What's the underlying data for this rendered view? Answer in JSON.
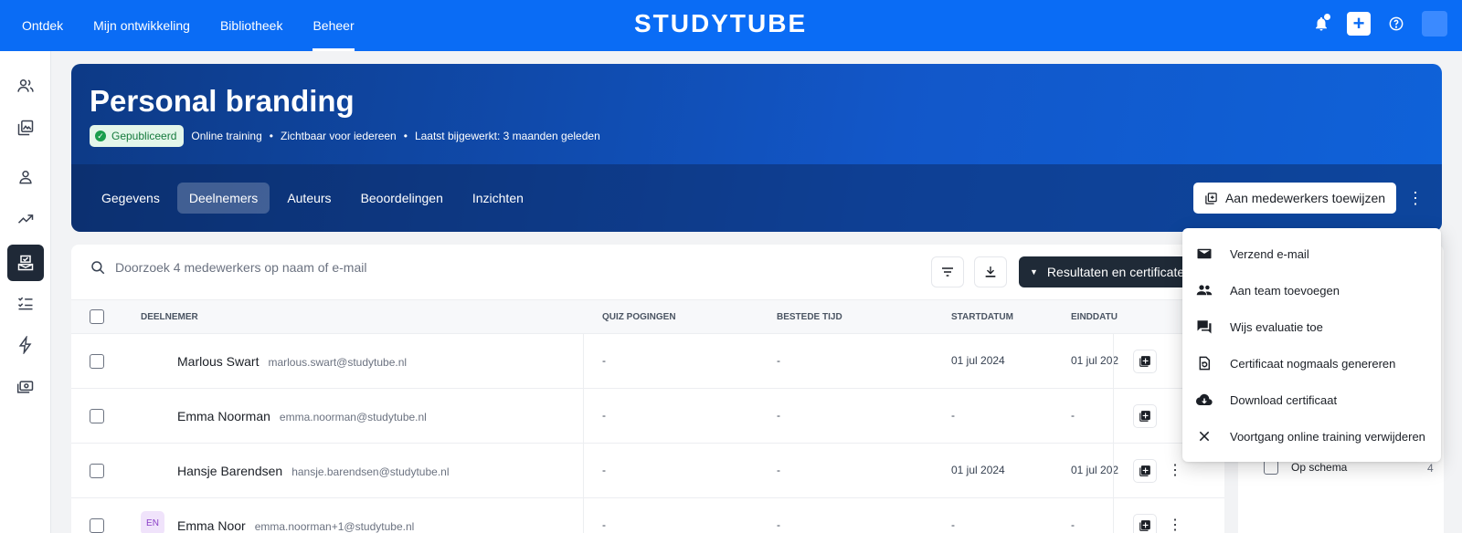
{
  "topnav": {
    "items": [
      "Ontdek",
      "Mijn ontwikkeling",
      "Bibliotheek",
      "Beheer"
    ],
    "active": "Beheer"
  },
  "brand": "STUDYTUBE",
  "colors": {
    "primary": "#0a6cf5",
    "dark": "#1f2a37",
    "published": "#1a9e4d"
  },
  "course": {
    "title": "Personal branding",
    "status": "Gepubliceerd",
    "meta": [
      "Online training",
      "Zichtbaar voor iedereen",
      "Laatst bijgewerkt: 3 maanden geleden"
    ]
  },
  "tabs": [
    "Gegevens",
    "Deelnemers",
    "Auteurs",
    "Beoordelingen",
    "Inzichten"
  ],
  "assign_button": "Aan medewerkers toewijzen",
  "search": {
    "placeholder": "Doorzoek 4 medewerkers op naam of e-mail"
  },
  "results_button": "Resultaten en certificaten",
  "table": {
    "columns": [
      "DEELNEMER",
      "QUIZ POGINGEN",
      "BESTEDE TIJD",
      "STARTDATUM",
      "EINDDATU"
    ],
    "rows": [
      {
        "name": "Marlous Swart",
        "email": "marlous.swart@studytube.nl",
        "quiz": "-",
        "time": "-",
        "start": "01 jul 2024",
        "end": "01 jul 202"
      },
      {
        "name": "Emma Noorman",
        "email": "emma.noorman@studytube.nl",
        "quiz": "-",
        "time": "-",
        "start": "-",
        "end": "-"
      },
      {
        "name": "Hansje Barendsen",
        "email": "hansje.barendsen@studytube.nl",
        "quiz": "-",
        "time": "-",
        "start": "01 jul 2024",
        "end": "01 jul 202"
      },
      {
        "initials": "EN",
        "name": "Emma Noor",
        "email": "emma.noorman+1@studytube.nl",
        "quiz": "-",
        "time": "-",
        "start": "-",
        "end": "-"
      }
    ]
  },
  "right_panel": {
    "item_label": "Op schema",
    "item_count": "4"
  },
  "menu": {
    "items": [
      {
        "icon": "mail-icon",
        "label": "Verzend e-mail"
      },
      {
        "icon": "people-icon",
        "label": "Aan team toevoegen"
      },
      {
        "icon": "chat-icon",
        "label": "Wijs evaluatie toe"
      },
      {
        "icon": "certificate-refresh-icon",
        "label": "Certificaat nogmaals genereren"
      },
      {
        "icon": "cloud-download-icon",
        "label": "Download certificaat"
      },
      {
        "icon": "close-icon",
        "label": "Voortgang online training verwijderen"
      }
    ]
  }
}
